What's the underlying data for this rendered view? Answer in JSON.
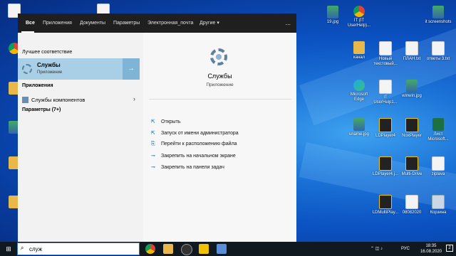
{
  "tabs": [
    "Все",
    "Приложения",
    "Документы",
    "Параметры",
    "Электронная_почта",
    "Другие"
  ],
  "more_label": "...",
  "left": {
    "best_match_title": "Лучшее соответствие",
    "best_name": "Службы",
    "best_type": "Приложение",
    "apps_title": "Приложения",
    "app_item": "Службы компонентов",
    "params": "Параметры (7+)"
  },
  "right": {
    "name": "Службы",
    "type": "Приложение",
    "actions": [
      "Открыть",
      "Запуск от имени администратора",
      "Перейти к расположению файла",
      "Закрепить на начальном экране",
      "Закрепить на панели задач"
    ]
  },
  "search": {
    "value": "служ"
  },
  "desktop_icons": [
    "19.jpg",
    "IT (IT UserHelp)...",
    "it screenshots",
    "канал",
    "Новый текстовый...",
    "ПЛАН.txt",
    "ответы 3.txt",
    "Microsoft Edge",
    "IT UserHelp1...",
    "winwin.jpg",
    "uname.jpg",
    "LDPlayer4",
    "NoxPlayer",
    "Лист Microsoft...",
    "LDPlayer4.j...",
    "Multi-Drive",
    "ziplava",
    "LDMultiPlay...",
    "08082020",
    "Корзина"
  ],
  "tray": {
    "lang": "РУС",
    "time": "18:35",
    "date": "16.08.2020",
    "notif": "2"
  }
}
